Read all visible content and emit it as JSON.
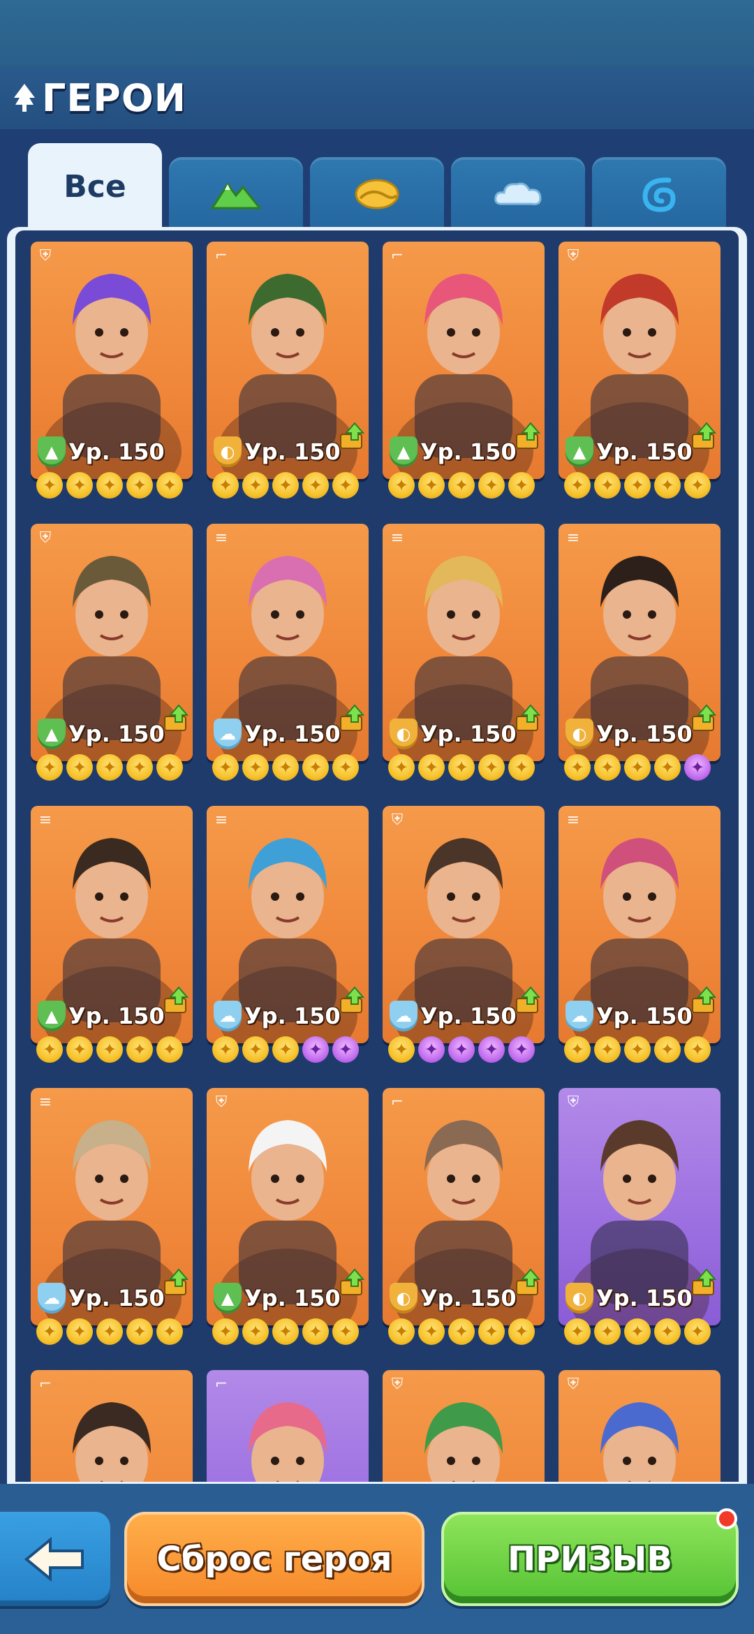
{
  "header": {
    "title": "ГЕРОИ"
  },
  "tabs": [
    {
      "label": "Все",
      "icon": "all-tab",
      "active": true
    },
    {
      "label": "",
      "icon": "mountain-icon",
      "active": false
    },
    {
      "label": "",
      "icon": "desert-icon",
      "active": false
    },
    {
      "label": "",
      "icon": "cloud-icon",
      "active": false
    },
    {
      "label": "",
      "icon": "water-wave-icon",
      "active": false
    }
  ],
  "heroes": [
    {
      "level": "Ур. 150",
      "element": "forest",
      "class": "shield",
      "bg": "orange",
      "stars": [
        "gold",
        "gold",
        "gold",
        "gold",
        "gold"
      ],
      "upgrade": false
    },
    {
      "level": "Ур. 150",
      "element": "desert",
      "class": "gun",
      "bg": "orange",
      "stars": [
        "gold",
        "gold",
        "gold",
        "gold",
        "gold"
      ],
      "upgrade": true
    },
    {
      "level": "Ур. 150",
      "element": "forest",
      "class": "gun",
      "bg": "orange",
      "stars": [
        "gold",
        "gold",
        "gold",
        "gold",
        "gold"
      ],
      "upgrade": true
    },
    {
      "level": "Ур. 150",
      "element": "forest",
      "class": "shield",
      "bg": "orange",
      "stars": [
        "gold",
        "gold",
        "gold",
        "gold",
        "gold"
      ],
      "upgrade": true
    },
    {
      "level": "Ур. 150",
      "element": "forest",
      "class": "shield",
      "bg": "orange",
      "stars": [
        "gold",
        "gold",
        "gold",
        "gold",
        "gold"
      ],
      "upgrade": true
    },
    {
      "level": "Ур. 150",
      "element": "sky",
      "class": "rifle",
      "bg": "orange",
      "stars": [
        "gold",
        "gold",
        "gold",
        "gold",
        "gold"
      ],
      "upgrade": true
    },
    {
      "level": "Ур. 150",
      "element": "desert",
      "class": "rifle",
      "bg": "orange",
      "stars": [
        "gold",
        "gold",
        "gold",
        "gold",
        "gold"
      ],
      "upgrade": true
    },
    {
      "level": "Ур. 150",
      "element": "desert",
      "class": "rifle",
      "bg": "orange",
      "stars": [
        "gold",
        "gold",
        "gold",
        "gold",
        "purple"
      ],
      "upgrade": true
    },
    {
      "level": "Ур. 150",
      "element": "forest",
      "class": "rifle",
      "bg": "orange",
      "stars": [
        "gold",
        "gold",
        "gold",
        "gold",
        "gold"
      ],
      "upgrade": true
    },
    {
      "level": "Ур. 150",
      "element": "sky",
      "class": "rifle",
      "bg": "orange",
      "stars": [
        "gold",
        "gold",
        "gold",
        "purple",
        "purple"
      ],
      "upgrade": true
    },
    {
      "level": "Ур. 150",
      "element": "sky",
      "class": "shield",
      "bg": "orange",
      "stars": [
        "gold",
        "purple",
        "purple",
        "purple",
        "purple"
      ],
      "upgrade": true
    },
    {
      "level": "Ур. 150",
      "element": "sky",
      "class": "rifle",
      "bg": "orange",
      "stars": [
        "gold",
        "gold",
        "gold",
        "gold",
        "gold"
      ],
      "upgrade": true
    },
    {
      "level": "Ур. 150",
      "element": "sky",
      "class": "rifle",
      "bg": "orange",
      "stars": [
        "gold",
        "gold",
        "gold",
        "gold",
        "gold"
      ],
      "upgrade": true
    },
    {
      "level": "Ур. 150",
      "element": "forest",
      "class": "shield",
      "bg": "orange",
      "stars": [
        "gold",
        "gold",
        "gold",
        "gold",
        "gold"
      ],
      "upgrade": true
    },
    {
      "level": "Ур. 150",
      "element": "desert",
      "class": "gun",
      "bg": "orange",
      "stars": [
        "gold",
        "gold",
        "gold",
        "gold",
        "gold"
      ],
      "upgrade": true
    },
    {
      "level": "Ур. 150",
      "element": "desert",
      "class": "shield",
      "bg": "purple",
      "stars": [
        "gold",
        "gold",
        "gold",
        "gold",
        "gold"
      ],
      "upgrade": true
    },
    {
      "level": "",
      "element": "",
      "class": "gun",
      "bg": "orange",
      "stars": [],
      "upgrade": false
    },
    {
      "level": "",
      "element": "",
      "class": "gun",
      "bg": "purple",
      "stars": [],
      "upgrade": false
    },
    {
      "level": "",
      "element": "",
      "class": "shield",
      "bg": "orange",
      "stars": [],
      "upgrade": false
    },
    {
      "level": "",
      "element": "",
      "class": "shield",
      "bg": "orange",
      "stars": [],
      "upgrade": false
    }
  ],
  "footer": {
    "reset_label": "Сброс героя",
    "summon_label": "ПРИЗЫВ",
    "back_icon": "back-arrow-icon",
    "summon_has_notification": true
  },
  "colors": {
    "card_orange": "#f28a3e",
    "card_purple": "#a377e3",
    "background": "#1f3f74",
    "panel": "#e9f3fb"
  }
}
